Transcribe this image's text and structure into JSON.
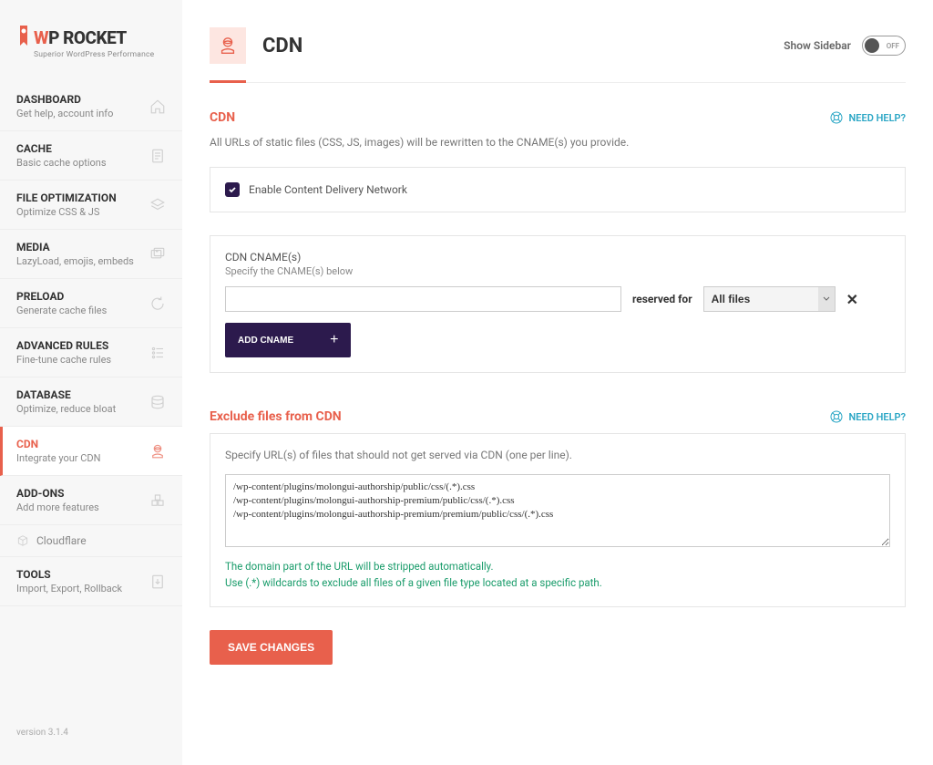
{
  "logo": {
    "brand1": "W",
    "brand2": "P",
    "brand3": " ROCKET",
    "tagline": "Superior WordPress Performance"
  },
  "nav": [
    {
      "title": "DASHBOARD",
      "sub": "Get help, account info"
    },
    {
      "title": "CACHE",
      "sub": "Basic cache options"
    },
    {
      "title": "FILE OPTIMIZATION",
      "sub": "Optimize CSS & JS"
    },
    {
      "title": "MEDIA",
      "sub": "LazyLoad, emojis, embeds"
    },
    {
      "title": "PRELOAD",
      "sub": "Generate cache files"
    },
    {
      "title": "ADVANCED RULES",
      "sub": "Fine-tune cache rules"
    },
    {
      "title": "DATABASE",
      "sub": "Optimize, reduce bloat"
    },
    {
      "title": "CDN",
      "sub": "Integrate your CDN"
    },
    {
      "title": "ADD-ONS",
      "sub": "Add more features"
    },
    {
      "title": "TOOLS",
      "sub": "Import, Export, Rollback"
    }
  ],
  "sub_nav": {
    "cloudflare": "Cloudflare"
  },
  "version": "version 3.1.4",
  "page": {
    "title": "CDN",
    "show_sidebar": "Show Sidebar",
    "toggle_state": "OFF"
  },
  "need_help": "NEED HELP?",
  "section_cdn": {
    "title": "CDN",
    "desc": "All URLs of static files (CSS, JS, images) will be rewritten to the CNAME(s) you provide.",
    "enable_label": "Enable Content Delivery Network",
    "cname_label": "CDN CNAME(s)",
    "cname_sub": "Specify the CNAME(s) below",
    "cname_value": "",
    "reserved_label": "reserved for",
    "select_value": "All files",
    "remove": "✕",
    "add_btn": "ADD CNAME"
  },
  "section_exclude": {
    "title": "Exclude files from CDN",
    "desc": "Specify URL(s) of files that should not get served via CDN (one per line).",
    "textarea_value": "/wp-content/plugins/molongui-authorship/public/css/(.*).css\n/wp-content/plugins/molongui-authorship-premium/public/css/(.*).css\n/wp-content/plugins/molongui-authorship-premium/premium/public/css/(.*).css",
    "helper1": "The domain part of the URL will be stripped automatically.",
    "helper2": "Use (.*) wildcards to exclude all files of a given file type located at a specific path."
  },
  "save": "SAVE CHANGES"
}
